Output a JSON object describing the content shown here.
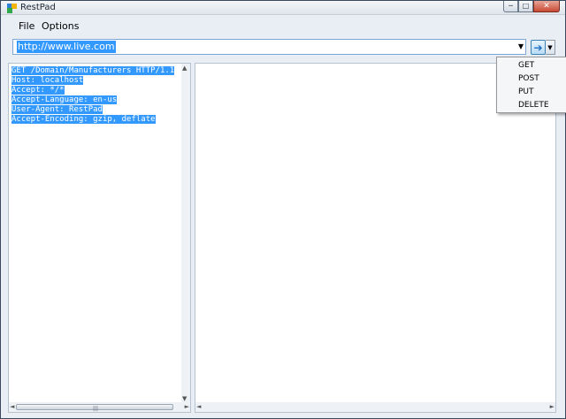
{
  "window": {
    "title": "RestPad"
  },
  "titlebar": {
    "minimize_glyph": "─",
    "maximize_glyph": "□",
    "close_glyph": "✕"
  },
  "menubar": {
    "items": [
      {
        "label": "File"
      },
      {
        "label": "Options"
      }
    ]
  },
  "url": {
    "value": "http://www.live.com",
    "dropdown_glyph": "▼",
    "go_glyph": "➔",
    "go_dropdown_glyph": "▼"
  },
  "request": {
    "lines": [
      "GET /Domain/Manufacturers HTTP/1.1",
      "Host: localhost",
      "Accept: */*",
      "Accept-Language: en-us",
      "User-Agent: RestPad",
      "Accept-Encoding: gzip, deflate"
    ]
  },
  "scroll": {
    "up": "▲",
    "down": "▼",
    "left": "◄",
    "right": "►",
    "grip": "|||"
  },
  "methods": {
    "items": [
      {
        "label": "GET"
      },
      {
        "label": "POST"
      },
      {
        "label": "PUT"
      },
      {
        "label": "DELETE"
      }
    ]
  },
  "icons": {
    "app": "restpad-app-icon",
    "go": "arrow-right-icon"
  },
  "colors": {
    "selection": "#3399ff",
    "accent": "#1b6cbf"
  }
}
